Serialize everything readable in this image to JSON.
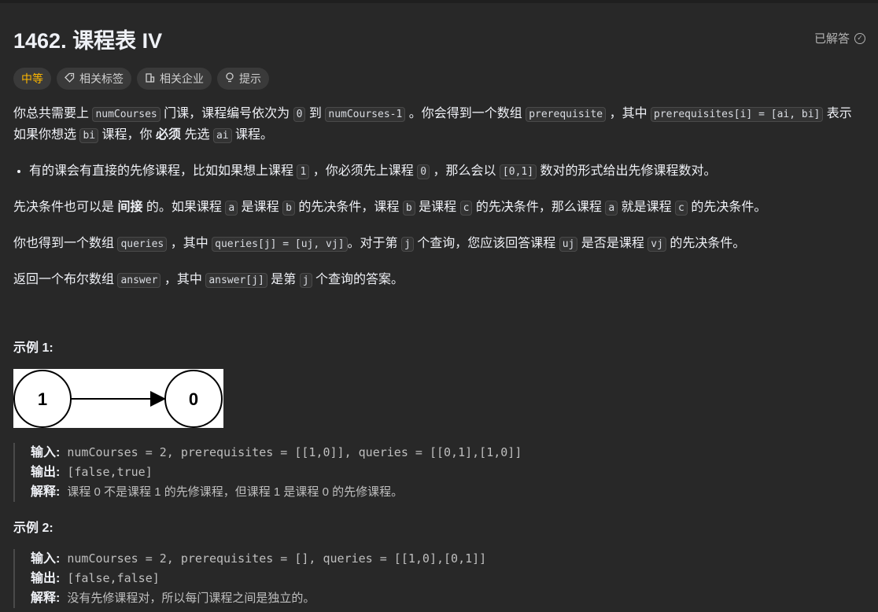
{
  "problem": {
    "title": "1462. 课程表 IV",
    "solved_label": "已解答",
    "tags": {
      "difficulty": "中等",
      "related_tags": "相关标签",
      "related_companies": "相关企业",
      "hint": "提示"
    }
  },
  "statement": {
    "p1": {
      "t1": "你总共需要上 ",
      "c1": "numCourses",
      "t2": " 门课，课程编号依次为 ",
      "c2": "0",
      "t3": " 到 ",
      "c3": "numCourses-1",
      "t4": " 。你会得到一个数组 ",
      "c4": "prerequisite",
      "t5": " ，其中 ",
      "c5": "prerequisites[i] = [ai, bi]",
      "t6": " 表示如果你想选 ",
      "c6": "bi",
      "t7": " 课程，你 ",
      "b1": "必须",
      "t8": " 先选 ",
      "c7": "ai",
      "t9": " 课程。"
    },
    "bullet": {
      "t1": "有的课会有直接的先修课程，比如如果想上课程 ",
      "c1": "1",
      "t2": " ，你必须先上课程 ",
      "c2": "0",
      "t3": " ，那么会以 ",
      "c3": "[0,1]",
      "t4": " 数对的形式给出先修课程数对。"
    },
    "p2": {
      "t1": "先决条件也可以是 ",
      "b1": "间接",
      "t2": " 的。如果课程 ",
      "c1": "a",
      "t3": " 是课程 ",
      "c2": "b",
      "t4": " 的先决条件，课程 ",
      "c3": "b",
      "t5": " 是课程 ",
      "c4": "c",
      "t6": " 的先决条件，那么课程 ",
      "c5": "a",
      "t7": " 就是课程 ",
      "c6": "c",
      "t8": " 的先决条件。"
    },
    "p3": {
      "t1": "你也得到一个数组 ",
      "c1": "queries",
      "t2": " ，其中 ",
      "c2": "queries[j] = [uj, vj]",
      "t3": "。对于第 ",
      "c3": "j",
      "t4": " 个查询，您应该回答课程 ",
      "c4": "uj",
      "t5": " 是否是课程 ",
      "c5": "vj",
      "t6": " 的先决条件。"
    },
    "p4": {
      "t1": "返回一个布尔数组 ",
      "c1": "answer",
      "t2": " ，其中 ",
      "c2": "answer[j]",
      "t3": " 是第 ",
      "c3": "j",
      "t4": " 个查询的答案。"
    }
  },
  "example1": {
    "heading": "示例 1:",
    "diagram": {
      "node_left": "1",
      "node_right": "0"
    },
    "input_label": "输入:",
    "input": "numCourses = 2, prerequisites = [[1,0]], queries = [[0,1],[1,0]]",
    "output_label": "输出:",
    "output": "[false,true]",
    "explain_label": "解释:",
    "explain": "课程 0 不是课程 1 的先修课程，但课程 1 是课程 0 的先修课程。"
  },
  "example2": {
    "heading": "示例 2:",
    "input_label": "输入:",
    "input": "numCourses = 2, prerequisites = [], queries = [[1,0],[0,1]]",
    "output_label": "输出:",
    "output": "[false,false]",
    "explain_label": "解释:",
    "explain": "没有先修课程对，所以每门课程之间是独立的。"
  }
}
